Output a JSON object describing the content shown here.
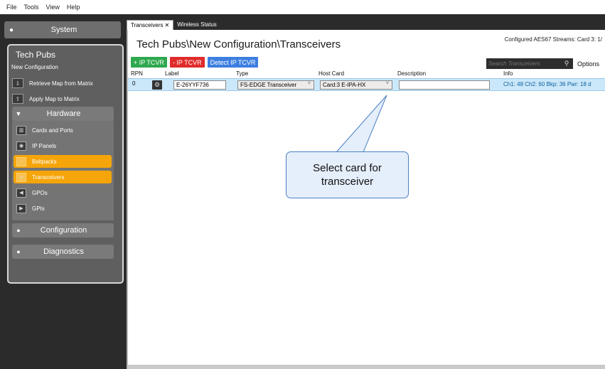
{
  "menu": [
    "File",
    "Tools",
    "View",
    "Help"
  ],
  "sidebar": {
    "system_label": "System",
    "project_title": "Tech Pubs",
    "project_subtitle": "New Configuration",
    "actions": [
      {
        "label": "Retrieve Map from Matrix",
        "icon": "download-map-icon"
      },
      {
        "label": "Apply Map to Matrix",
        "icon": "upload-map-icon"
      }
    ],
    "hardware": {
      "label": "Hardware",
      "items": [
        {
          "label": "Cards and Ports",
          "icon": "cards-icon",
          "active": false
        },
        {
          "label": "IP Panels",
          "icon": "ip-panel-icon",
          "active": false
        },
        {
          "label": "Beltpacks",
          "icon": "headset-icon",
          "active": true
        },
        {
          "label": "Transceivers",
          "icon": "transceiver-icon",
          "active": true
        },
        {
          "label": "GPOs",
          "icon": "gpo-icon",
          "active": false
        },
        {
          "label": "GPIs",
          "icon": "gpi-icon",
          "active": false
        }
      ]
    },
    "configuration_label": "Configuration",
    "diagnostics_label": "Diagnostics"
  },
  "tabs": [
    {
      "label": "Transceivers",
      "active": true,
      "closable": true
    },
    {
      "label": "Wireless Status",
      "active": false,
      "closable": false
    }
  ],
  "header": {
    "configured_streams": "Configured AES67 Streams:  Card 3: 1/",
    "title": "Tech Pubs\\New Configuration\\Transceivers"
  },
  "toolbar": {
    "add_label": "+ IP TCVR",
    "remove_label": "- IP TCVR",
    "detect_label": "Detect IP TCVR",
    "search_placeholder": "Search Transceivers",
    "options_label": "Options"
  },
  "table": {
    "columns": [
      "RPN",
      "Label",
      "Type",
      "Host Card",
      "Description",
      "Info"
    ],
    "rows": [
      {
        "rpn": "0",
        "label": "E-26YYF736",
        "type": "FS-EDGE Transceiver",
        "host_card": "Card:3 E-IPA-HX",
        "description": "",
        "info": "Ch1: 48  Ch2: 60  Bkp: 36  Pwr: 18 d"
      }
    ]
  },
  "callout": {
    "line1": "Select card for",
    "line2": "transceiver"
  },
  "colors": {
    "green": "#2fa84f",
    "red": "#e02b2b",
    "blue": "#3d7fe0",
    "active_orange": "#f5a50a",
    "row_highlight": "#cbe8fa"
  }
}
